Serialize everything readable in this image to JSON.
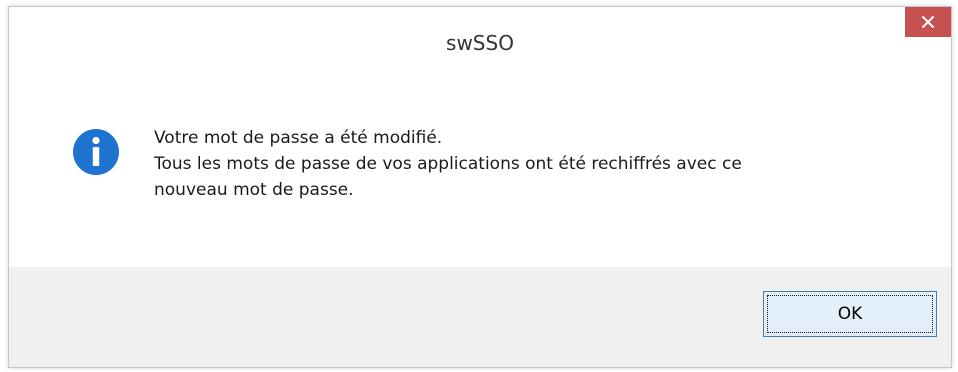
{
  "window": {
    "title": "swSSO",
    "close_icon": "close-icon",
    "close_color": "#c75050"
  },
  "message": {
    "icon": "info-icon",
    "icon_color": "#1e73d0",
    "line1": "Votre mot de passe a été modifié.",
    "line2": "Tous les mots de passe de vos applications ont été rechiffrés avec ce",
    "line3": "nouveau mot de passe."
  },
  "footer": {
    "ok_label": "OK"
  }
}
